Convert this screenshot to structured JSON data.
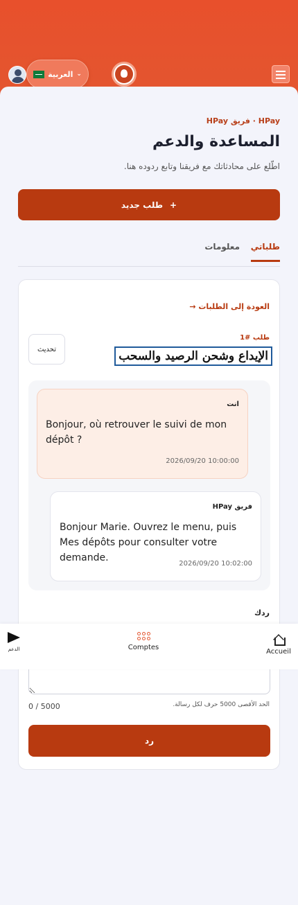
{
  "header": {
    "language_label": "العربية",
    "flag_icon": "saudi-flag-icon",
    "brand_color": "#e8502c"
  },
  "page": {
    "kicker": "HPay · فريق HPay",
    "title": "المساعدة والدعم",
    "subtitle": "اطّلع على محادثاتك مع فريقنا وتابع ردوده هنا.",
    "new_request_label": "طلب جديد",
    "new_request_icon": "+"
  },
  "tabs": [
    {
      "label": "طلباتي",
      "active": true
    },
    {
      "label": "معلومات",
      "active": false
    }
  ],
  "request": {
    "back_label": "العودة إلى الطلبات →",
    "number": "طلب #1",
    "title": "الإيداع وشحن الرصيد والسحب",
    "refresh_label": "تحديث"
  },
  "messages": [
    {
      "author": "انت",
      "text": "Bonjour, où retrouver le suivi de mon dépôt ?",
      "time": "2026/09/20 10:00:00"
    },
    {
      "author": "فريق HPay",
      "text": "Bonjour Marie. Ouvrez le menu, puis Mes dépôts pour consulter votre demande.",
      "time": "2026/09/20 10:02:00"
    }
  ],
  "reply": {
    "label": "ردك",
    "placeholder": "",
    "hint": "الحد الأقصى 5000 حرف لكل رسالة.",
    "counter": "0 / 5000",
    "submit_label": "رد"
  },
  "bottom_nav": [
    {
      "label": "Accueil",
      "icon": "home-icon"
    },
    {
      "label": "Comptes",
      "icon": "grid-icon"
    },
    {
      "label": "الدعم",
      "icon": "send-icon"
    }
  ]
}
